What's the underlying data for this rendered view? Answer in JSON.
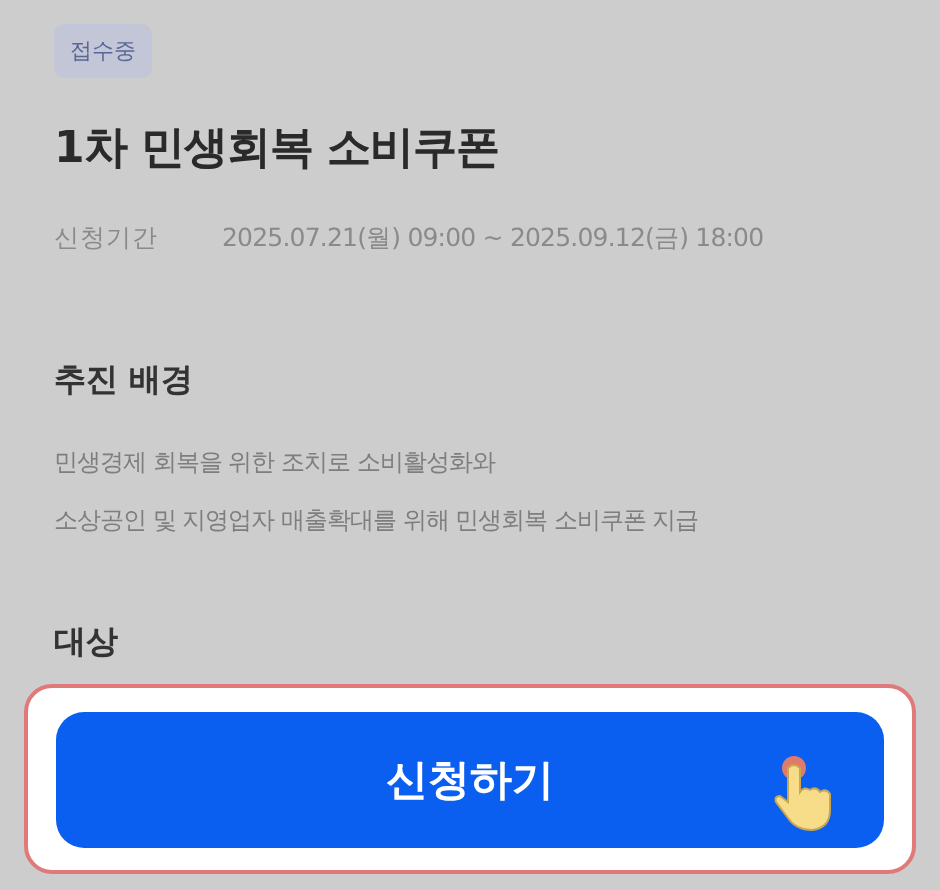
{
  "status_badge": "접수중",
  "title": "1차 민생회복 소비쿠폰",
  "period": {
    "label": "신청기간",
    "value": "2025.07.21(월) 09:00 ~ 2025.09.12(금) 18:00"
  },
  "sections": [
    {
      "heading": "추진 배경",
      "lines": [
        "민생경제 회복을 위한 조치로 소비활성화와",
        "소상공인 및 지영업자 매출확대를 위해 민생회복 소비쿠폰 지급"
      ]
    },
    {
      "heading": "대상"
    }
  ],
  "apply_button": {
    "label": "신청하기",
    "highlighted": true
  }
}
